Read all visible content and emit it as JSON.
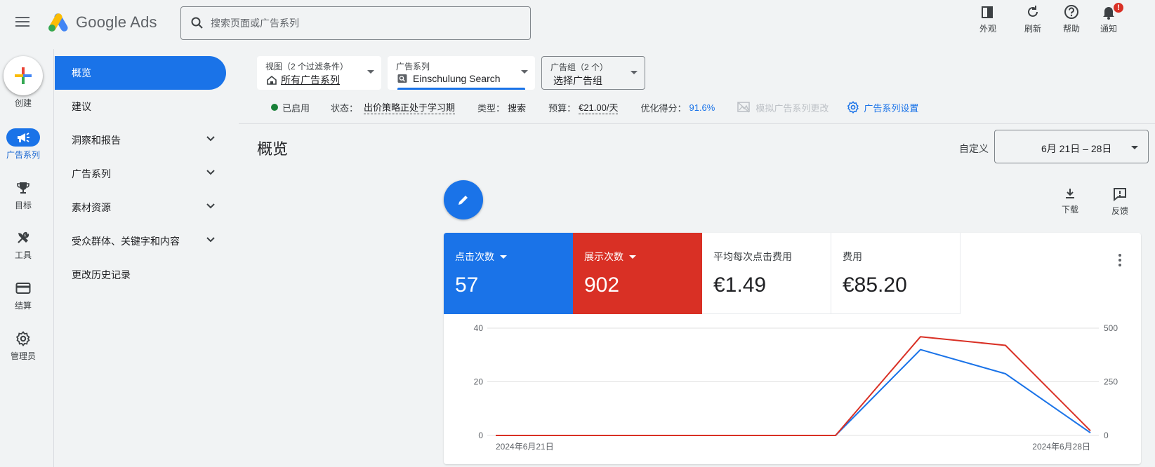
{
  "app": {
    "name": "Google Ads"
  },
  "search": {
    "placeholder": "搜索页面或广告系列"
  },
  "top_actions": [
    {
      "label": "外观",
      "icon": "appearance-icon"
    },
    {
      "label": "刷新",
      "icon": "refresh-icon"
    },
    {
      "label": "帮助",
      "icon": "help-icon"
    },
    {
      "label": "通知",
      "icon": "bell-icon",
      "badge": "!"
    }
  ],
  "rail": {
    "create_label": "创建",
    "items": [
      {
        "label": "广告系列",
        "icon": "campaign-icon",
        "active": true
      },
      {
        "label": "目标",
        "icon": "trophy-icon"
      },
      {
        "label": "工具",
        "icon": "tools-icon"
      },
      {
        "label": "结算",
        "icon": "billing-card-icon"
      },
      {
        "label": "管理员",
        "icon": "gear-icon"
      }
    ]
  },
  "sidenav": {
    "items": [
      {
        "label": "概览",
        "active": true
      },
      {
        "label": "建议"
      },
      {
        "label": "洞察和报告",
        "expandable": true
      },
      {
        "label": "广告系列",
        "expandable": true
      },
      {
        "label": "素材资源",
        "expandable": true
      },
      {
        "label": "受众群体、关键字和内容",
        "expandable": true
      },
      {
        "label": "更改历史记录"
      }
    ]
  },
  "filters": {
    "view": {
      "label": "视图（2 个过滤条件）",
      "value": "所有广告系列"
    },
    "campaign": {
      "label": "广告系列",
      "value": "Einschulung Search"
    },
    "ad_group": {
      "label": "广告组（2 个）",
      "value": "选择广告组"
    }
  },
  "status_bar": {
    "enabled": "已启用",
    "status_label": "状态：",
    "status_value": "出价策略正处于学习期",
    "type_label": "类型：",
    "type_value": "搜索",
    "budget_label": "预算：",
    "budget_value": "€21.00/天",
    "opt_label": "优化得分：",
    "opt_value": "91.6%",
    "simulate": "模拟广告系列更改",
    "settings": "广告系列设置"
  },
  "page": {
    "title": "概览",
    "custom_label": "自定义",
    "date_range": "6月 21日 – 28日"
  },
  "tools": {
    "download": "下载",
    "feedback": "反馈"
  },
  "metrics": [
    {
      "label": "点击次数",
      "value": "57",
      "color": "#1a73e8"
    },
    {
      "label": "展示次数",
      "value": "902",
      "color": "#d93025"
    },
    {
      "label": "平均每次点击费用",
      "value": "€1.49"
    },
    {
      "label": "费用",
      "value": "€85.20"
    }
  ],
  "chart_data": {
    "type": "line",
    "x": [
      "2024-06-21",
      "2024-06-22",
      "2024-06-23",
      "2024-06-24",
      "2024-06-25",
      "2024-06-26",
      "2024-06-27",
      "2024-06-28"
    ],
    "x_tick_labels": [
      "2024年6月21日",
      "2024年6月28日"
    ],
    "series": [
      {
        "name": "点击次数",
        "axis": "left",
        "color": "#1a73e8",
        "values": [
          0,
          0,
          0,
          0,
          0,
          32,
          23,
          1
        ]
      },
      {
        "name": "展示次数",
        "axis": "right",
        "color": "#d93025",
        "values": [
          0,
          0,
          0,
          0,
          0,
          460,
          420,
          22
        ]
      }
    ],
    "y_left": {
      "ylim": [
        0,
        40
      ],
      "ticks": [
        "0",
        "20",
        "40"
      ]
    },
    "y_right": {
      "ylim": [
        0,
        500
      ],
      "ticks": [
        "0",
        "250",
        "500"
      ]
    },
    "grid": true
  }
}
